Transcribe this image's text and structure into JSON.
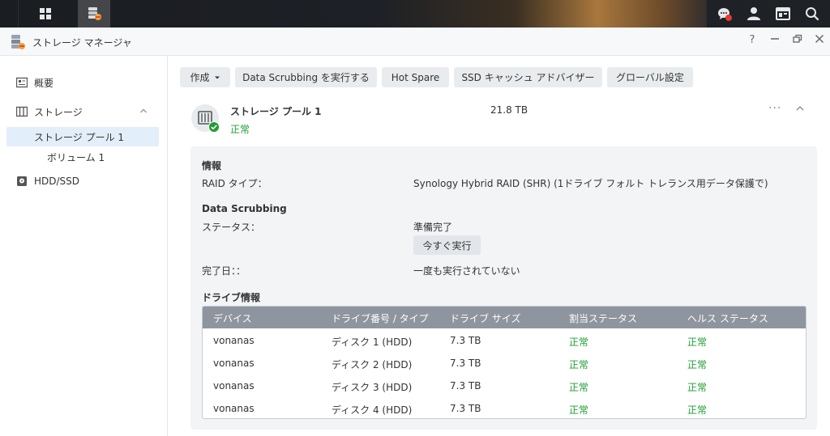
{
  "window": {
    "title": "ストレージ マネージャ",
    "help": "?"
  },
  "sidebar": {
    "items": [
      {
        "label": "概要"
      },
      {
        "label": "ストレージ"
      },
      {
        "label": "ストレージ プール 1"
      },
      {
        "label": "ボリューム 1"
      },
      {
        "label": "HDD/SSD"
      }
    ]
  },
  "toolbar": {
    "create": "作成",
    "scrub": "Data Scrubbing を実行する",
    "hotspare": "Hot Spare",
    "ssd": "SSD キャッシュ アドバイザー",
    "global": "グローバル設定"
  },
  "pool": {
    "name": "ストレージ プール 1",
    "status": "正常",
    "size": "21.8 TB",
    "more": "···"
  },
  "info": {
    "heading": "情報",
    "raid_label": "RAID タイプ：",
    "raid_value": "Synology Hybrid RAID (SHR) (1ドライブ フォルト トレランス用データ保護で)"
  },
  "scrubbing": {
    "heading": "Data Scrubbing",
    "status_label": "ステータス：",
    "status_value": "準備完了",
    "run_now": "今すぐ実行",
    "done_label": "完了日：：",
    "done_value": "一度も実行されていない"
  },
  "drives": {
    "heading": "ドライブ情報",
    "columns": [
      "デバイス",
      "ドライブ番号 / タイプ",
      "ドライブ サイズ",
      "割当ステータス",
      "ヘルス ステータス"
    ],
    "rows": [
      {
        "device": "vonanas",
        "slot": "ディスク 1 (HDD)",
        "size": "7.3 TB",
        "alloc": "正常",
        "health": "正常"
      },
      {
        "device": "vonanas",
        "slot": "ディスク 2 (HDD)",
        "size": "7.3 TB",
        "alloc": "正常",
        "health": "正常"
      },
      {
        "device": "vonanas",
        "slot": "ディスク 3 (HDD)",
        "size": "7.3 TB",
        "alloc": "正常",
        "health": "正常"
      },
      {
        "device": "vonanas",
        "slot": "ディスク 4 (HDD)",
        "size": "7.3 TB",
        "alloc": "正常",
        "health": "正常"
      }
    ]
  },
  "colors": {
    "ok": "#1e9e33",
    "selected": "#e3eefb",
    "table_header": "#8e959e"
  }
}
